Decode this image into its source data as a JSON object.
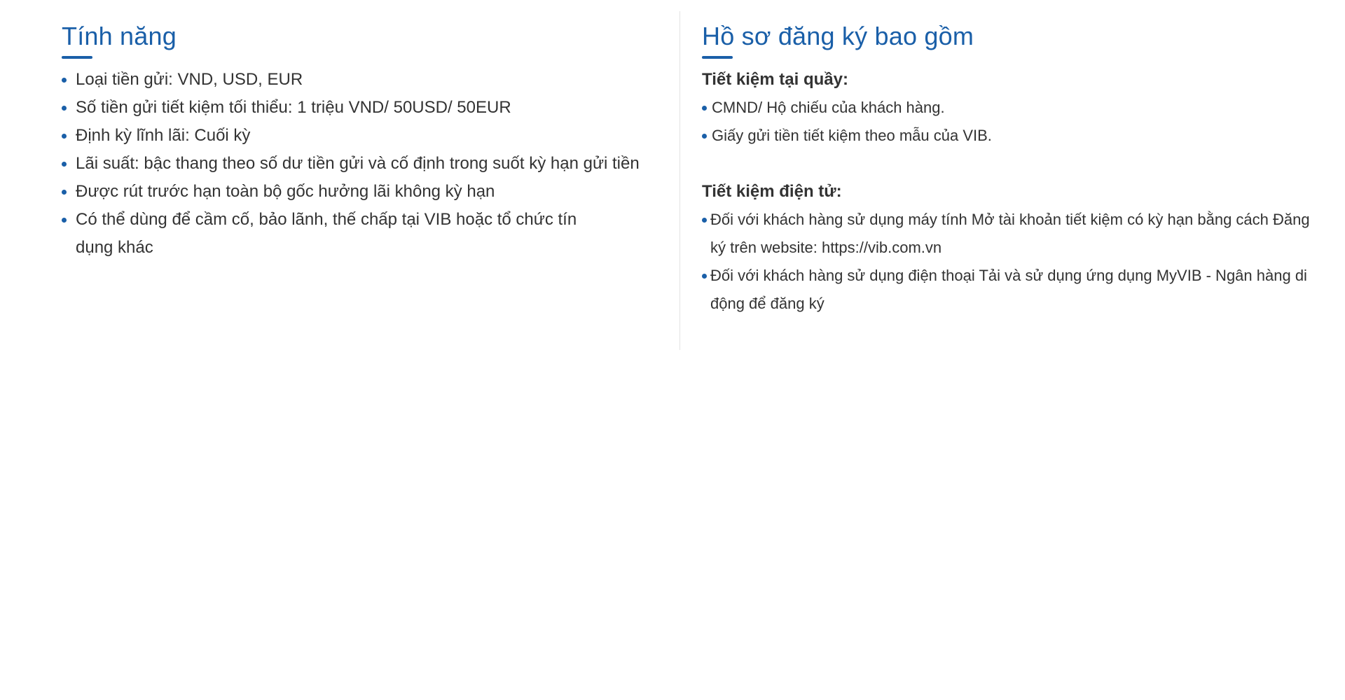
{
  "features": {
    "title": "Tính năng",
    "items": [
      "Loại tiền gửi: VND, USD, EUR",
      "Số tiền gửi tiết kiệm tối thiểu: 1 triệu VND/ 50USD/ 50EUR",
      "Định kỳ lĩnh lãi: Cuối kỳ",
      "Lãi suất: bậc thang theo số dư tiền gửi và cố định trong suốt kỳ hạn gửi tiền",
      "Được rút trước hạn toàn bộ gốc hưởng lãi không kỳ hạn",
      "Có thể dùng để cầm cố, bảo lãnh, thế chấp tại VIB hoặc tổ chức tín dụng khác"
    ]
  },
  "documents": {
    "title": "Hồ sơ đăng ký bao gồm",
    "counter": {
      "heading": "Tiết kiệm tại quầy:",
      "items": [
        "CMND/ Hộ chiếu của khách hàng.",
        "Giấy gửi tiền tiết kiệm theo mẫu của VIB."
      ]
    },
    "online": {
      "heading": "Tiết kiệm điện tử:",
      "items": [
        "Đối với khách hàng sử dụng máy tính Mở tài khoản tiết kiệm có kỳ hạn bằng cách Đăng ký trên website: https://vib.com.vn",
        "Đối với khách hàng sử dụng điện thoại Tải và sử dụng ứng dụng MyVIB - Ngân hàng di động để đăng ký"
      ]
    }
  },
  "colors": {
    "accent": "#1a5fa8",
    "text": "#333333",
    "divider": "#e3e3e3"
  }
}
